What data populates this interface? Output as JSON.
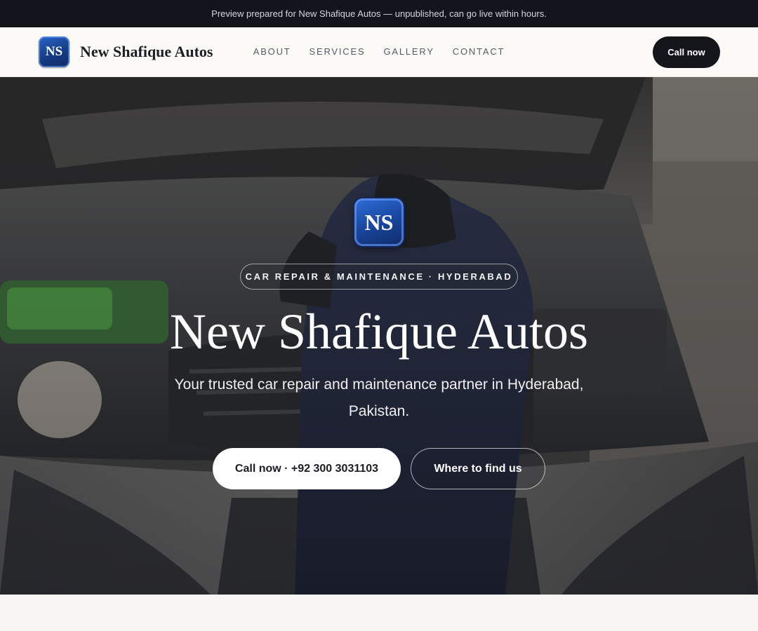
{
  "announcement": "Preview prepared for New Shafique Autos — unpublished, can go live within hours.",
  "brand": {
    "logo_text": "NS",
    "name": "New Shafique Autos"
  },
  "nav": {
    "items": [
      "ABOUT",
      "SERVICES",
      "GALLERY",
      "CONTACT"
    ],
    "cta_label": "Call now"
  },
  "hero": {
    "logo_text": "NS",
    "tagline": "CAR REPAIR & MAINTENANCE · HYDERABAD",
    "title": "New Shafique Autos",
    "subtitle": "Your trusted car repair and maintenance partner in Hyderabad, Pakistan.",
    "primary_cta": "Call now · +92 300 3031103",
    "secondary_cta": "Where to find us",
    "background_image": "mechanic-working-under-car-hood-photo"
  },
  "colors": {
    "topbar": "#12151b",
    "nav_cta": "#14161b",
    "logo_blue": "#1a47a0",
    "page_bg": "#f8f7f3"
  }
}
